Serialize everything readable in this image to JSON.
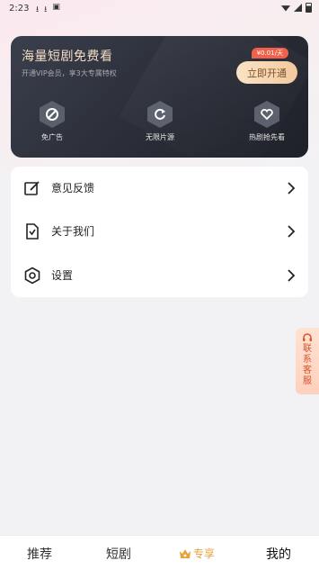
{
  "status_bar": {
    "time": "2:23"
  },
  "vip_card": {
    "title": "海量短剧免费看",
    "subtitle": "开通VIP会员，享3大专属特权",
    "price_badge": "¥0.01/天",
    "open_button": "立即开通",
    "benefits": [
      {
        "icon": "no-ads-icon",
        "label": "免广告"
      },
      {
        "icon": "refresh-icon",
        "label": "无限片源"
      },
      {
        "icon": "heart-icon",
        "label": "热剧抢先看"
      }
    ]
  },
  "menu": {
    "items": [
      {
        "icon": "edit-icon",
        "label": "意见反馈"
      },
      {
        "icon": "document-icon",
        "label": "关于我们"
      },
      {
        "icon": "gear-icon",
        "label": "设置"
      }
    ]
  },
  "service": {
    "label": "联系客服"
  },
  "bottom_nav": {
    "items": [
      {
        "label": "推荐"
      },
      {
        "label": "短剧"
      },
      {
        "label": "专享",
        "icon": "crown-icon"
      },
      {
        "label": "我的",
        "active": true
      }
    ]
  },
  "colors": {
    "accent_gold": "#f2c89c",
    "price_red": "#ef5c45",
    "vip_nav": "#e8a23a",
    "card_dark": "#2a2d37"
  }
}
